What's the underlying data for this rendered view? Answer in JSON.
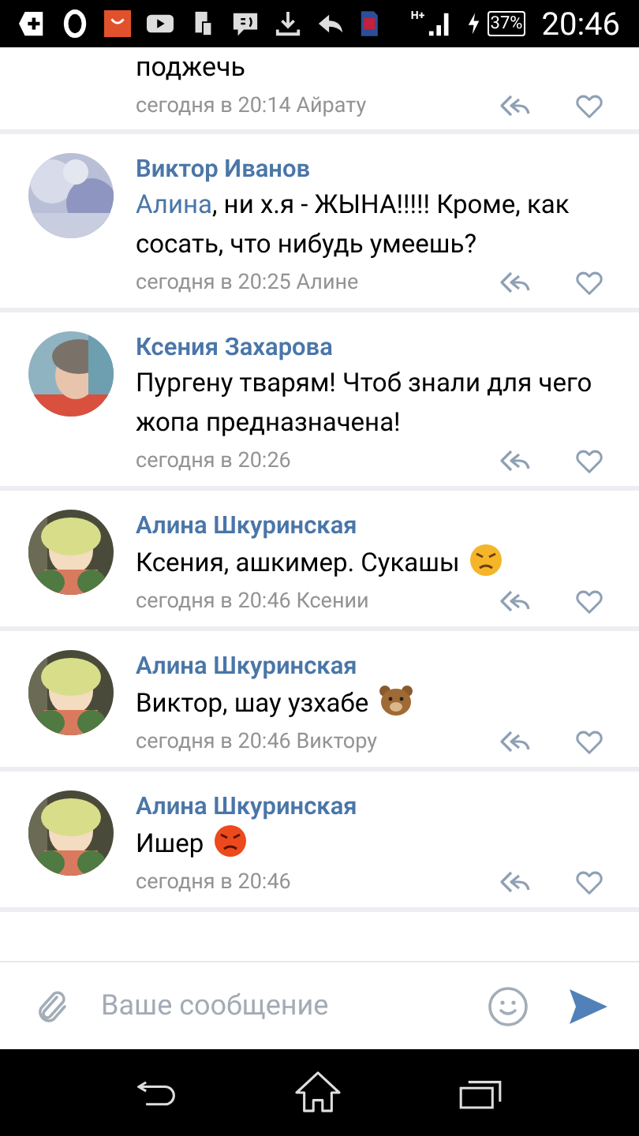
{
  "status_bar": {
    "network": "H+",
    "battery": "37%",
    "time": "20:46"
  },
  "partial_comment": {
    "text": "поджечь",
    "meta": "сегодня в 20:14 Айрату"
  },
  "comments": [
    {
      "author": "Виктор Иванов",
      "mention": "Алина",
      "text": ", ни х.я - ЖЫНА!!!!! Кроме, как сосать, что нибудь умеешь?",
      "meta": "сегодня в 20:25 Алине"
    },
    {
      "author": "Ксения Захарова",
      "text": "Пургену тварям! Чтоб знали для чего жопа предназначена!",
      "meta": "сегодня в 20:26"
    },
    {
      "author": "Алина Шкуринская",
      "text": "Ксения, ашкимер. Сукашы",
      "emoji": {
        "kind": "angry"
      },
      "meta": "сегодня в 20:46 Ксении"
    },
    {
      "author": "Алина Шкуринская",
      "text": "Виктор, шау узхабе",
      "emoji": {
        "kind": "bear"
      },
      "meta": "сегодня в 20:46 Виктору"
    },
    {
      "author": "Алина Шкуринская",
      "text": "Ишер",
      "emoji": {
        "kind": "rage"
      },
      "meta": "сегодня в 20:46"
    }
  ],
  "composer": {
    "placeholder": "Ваше сообщение"
  }
}
